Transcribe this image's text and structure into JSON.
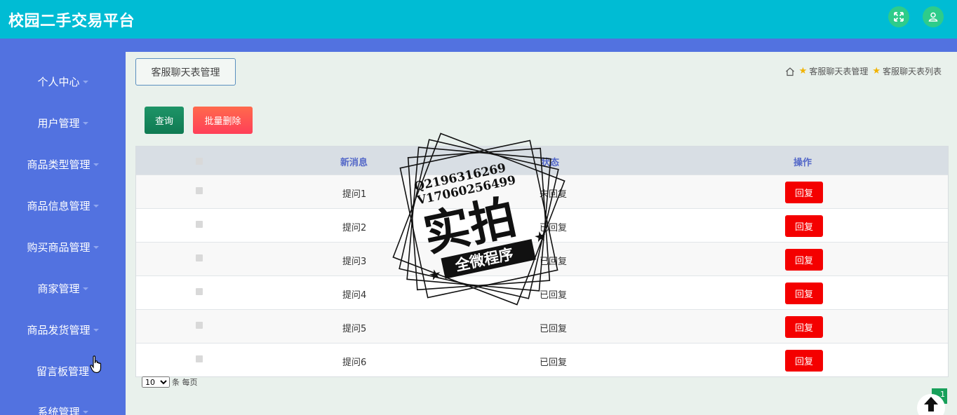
{
  "app": {
    "title": "校园二手交易平台"
  },
  "header": {
    "fullscreen_icon": "fullscreen-icon",
    "user_icon": "user-icon"
  },
  "sidebar": {
    "items": [
      {
        "label": "个人中心",
        "has_caret": true
      },
      {
        "label": "用户管理",
        "has_caret": true
      },
      {
        "label": "商品类型管理",
        "has_caret": true
      },
      {
        "label": "商品信息管理",
        "has_caret": true
      },
      {
        "label": "购买商品管理",
        "has_caret": true
      },
      {
        "label": "商家管理",
        "has_caret": true
      },
      {
        "label": "商品发货管理",
        "has_caret": true
      },
      {
        "label": "留言板管理",
        "has_caret": false
      },
      {
        "label": "系统管理",
        "has_caret": true
      }
    ]
  },
  "page": {
    "tab_label": "客服聊天表管理"
  },
  "breadcrumb": {
    "items": [
      "客服聊天表管理",
      "客服聊天表列表"
    ]
  },
  "toolbar": {
    "query_label": "查询",
    "batch_delete_label": "批量删除"
  },
  "table": {
    "columns": [
      "新消息",
      "状态",
      "操作"
    ],
    "rows": [
      {
        "message": "提问1",
        "status": "未回复",
        "action": "回复"
      },
      {
        "message": "提问2",
        "status": "已回复",
        "action": "回复"
      },
      {
        "message": "提问3",
        "status": "已回复",
        "action": "回复"
      },
      {
        "message": "提问4",
        "status": "已回复",
        "action": "回复"
      },
      {
        "message": "提问5",
        "status": "已回复",
        "action": "回复"
      },
      {
        "message": "提问6",
        "status": "已回复",
        "action": "回复"
      }
    ]
  },
  "pagination": {
    "page_size": "10",
    "per_page_text": "条 每页",
    "current_page": "1"
  },
  "watermark": {
    "line1": "Q2196316269",
    "line2": "V17060256499",
    "big_text": "实拍",
    "banner_text": "全微程序"
  },
  "colors": {
    "topbar": "#00bcd4",
    "sidebar": "#5272e0",
    "main_bg": "#e9f1ec",
    "reply_button": "#f40000",
    "query_button": "#0f7a52",
    "delete_button": "#ff3f58"
  }
}
